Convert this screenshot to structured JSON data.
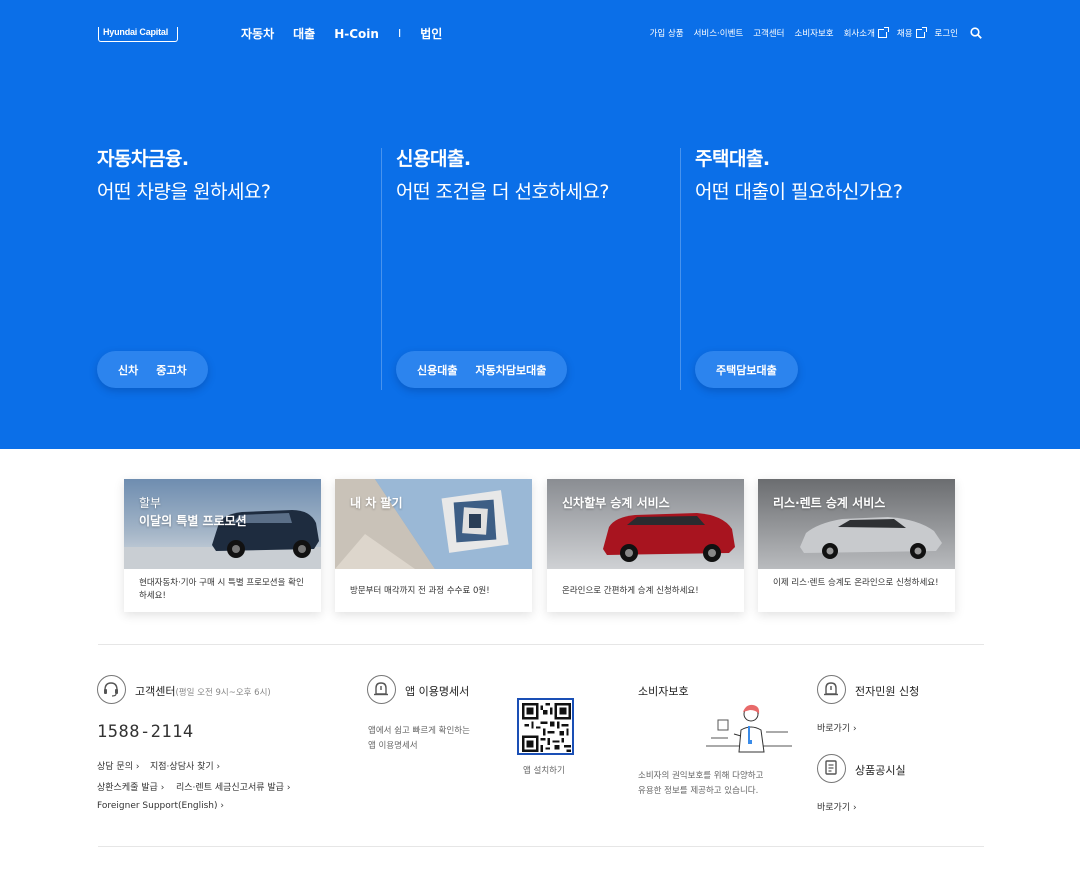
{
  "brand": {
    "logo_text": "Hyundai Capital"
  },
  "main_nav": {
    "car": "자동차",
    "loan": "대출",
    "hcoin": "H-Coin",
    "separator": "I",
    "corp": "법인"
  },
  "util_nav": {
    "items": [
      "가입 상품",
      "서비스·이벤트",
      "고객센터",
      "소비자보호",
      "회사소개",
      "채용",
      "로그인"
    ]
  },
  "hero": {
    "columns": [
      {
        "title": "자동차금융.",
        "subtitle": "어떤 차량을 원하세요?",
        "buttons": [
          "신차",
          "중고차"
        ]
      },
      {
        "title": "신용대출.",
        "subtitle": "어떤 조건을 더 선호하세요?",
        "buttons": [
          "신용대출",
          "자동차담보대출"
        ]
      },
      {
        "title": "주택대출.",
        "subtitle": "어떤 대출이 필요하신가요?",
        "buttons": [
          "주택담보대출"
        ]
      }
    ]
  },
  "cards": [
    {
      "title_small": "할부",
      "title": "이달의 특별 프로모션",
      "desc": "현대자동차·기아 구매 시 특별 프로모션을 확인하세요!"
    },
    {
      "title": "내 차 팔기",
      "desc": "방문부터 매각까지 전 과정 수수료 0원!"
    },
    {
      "title": "신차할부 승계 서비스",
      "desc": "온라인으로 간편하게 승계 신청하세요!"
    },
    {
      "title": "리스·렌트 승계 서비스",
      "desc": "이제 리스·렌트 승계도 온라인으로 신청하세요!"
    }
  ],
  "footer": {
    "cs": {
      "title": "고객센터",
      "hours": "(평일 오전 9시~오후 6시)",
      "phone": "1588-2114",
      "links": [
        "상담 문의",
        "지점·상담사 찾기",
        "상환스케줄 발급",
        "리스·렌트 세금신고서류 발급",
        "Foreigner Support(English)"
      ]
    },
    "app": {
      "title": "앱 이용명세서",
      "desc1": "앱에서 쉽고 빠르게 확인하는",
      "desc2": "앱 이용명세서",
      "install": "앱 설치하기"
    },
    "consumer": {
      "title": "소비자보호",
      "desc1": "소비자의 권익보호를 위해 다양하고",
      "desc2": "유용한 정보를 제공하고 있습니다."
    },
    "complaint": {
      "title": "전자민원 신청",
      "link": "바로가기"
    },
    "notice": {
      "title": "상품공시실",
      "link": "바로가기"
    }
  },
  "colors": {
    "hero_bg": "#0b6fe8",
    "pill_bg": "#2c84ee"
  }
}
